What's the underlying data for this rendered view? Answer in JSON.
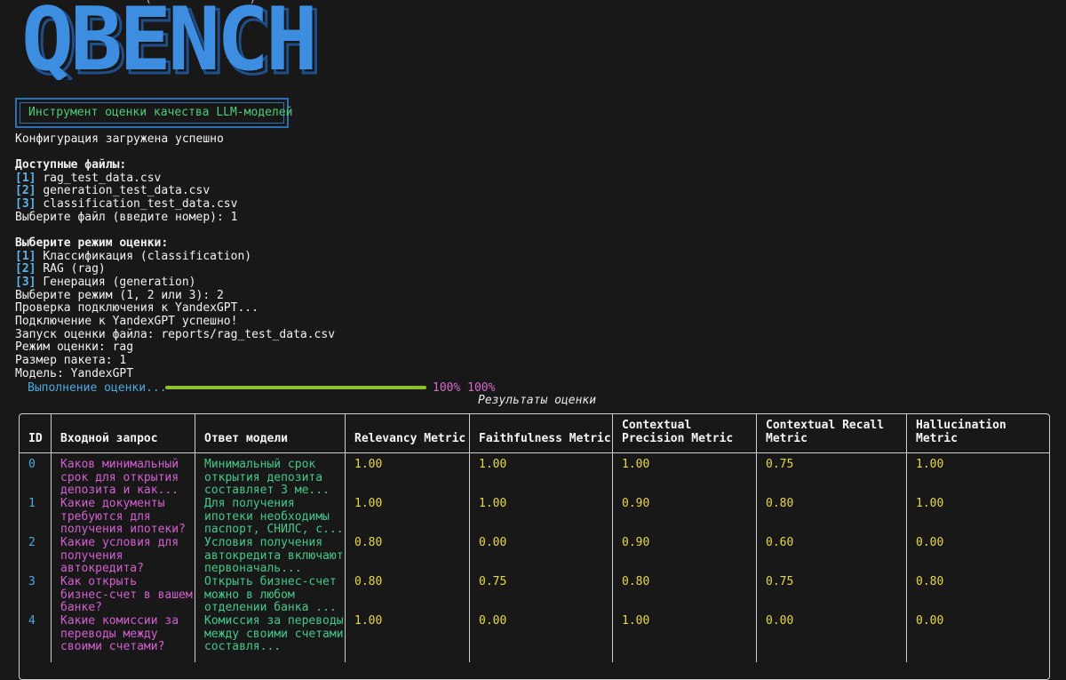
{
  "header_line": "                 (              )                        ",
  "logo_text": "QBENCH",
  "banner": "Инструмент оценки качества LLM-моделей",
  "config_loaded": "Конфигурация загружена успешно",
  "files_heading": "Доступные файлы:",
  "files": [
    {
      "num": "1",
      "name": "rag_test_data.csv"
    },
    {
      "num": "2",
      "name": "generation_test_data.csv"
    },
    {
      "num": "3",
      "name": "classification_test_data.csv"
    }
  ],
  "file_prompt": "Выберите файл (введите номер): 1",
  "mode_heading": "Выберите режим оценки:",
  "modes": [
    {
      "num": "1",
      "name": "Классификация (classification)"
    },
    {
      "num": "2",
      "name": "RAG (rag)"
    },
    {
      "num": "3",
      "name": "Генерация (generation)"
    }
  ],
  "log": [
    "Выберите режим (1, 2 или 3): 2",
    "Проверка подключения к YandexGPT...",
    "Подключение к YandexGPT успешно!",
    "Запуск оценки файла: reports/rag_test_data.csv",
    "Режим оценки: rag",
    "Размер пакета: 1",
    "Модель: YandexGPT"
  ],
  "progress": {
    "label": "Выполнение оценки...",
    "value": 1.0,
    "text": "100% 100%"
  },
  "results_caption": "Результаты оценки",
  "table": {
    "headers": [
      "ID",
      "Входной запрос",
      "Ответ модели",
      "Relevancy Metric",
      "Faithfulness Metric",
      "Contextual\nPrecision Metric",
      "Contextual Recall\nMetric",
      "Hallucination\nMetric"
    ],
    "rows": [
      {
        "id": "0",
        "q": "Каков минимальный\nсрок для открытия\nдепозита и как...",
        "a": "Минимальный срок\nоткрытия депозита\nсоставляет 3 ме...",
        "m": [
          "1.00",
          "1.00",
          "1.00",
          "0.75",
          "1.00"
        ]
      },
      {
        "id": "1",
        "q": "Какие документы\nтребуются для\nполучения ипотеки?",
        "a": "Для получения\nипотеки необходимы\nпаспорт, СНИЛС, с...",
        "m": [
          "1.00",
          "1.00",
          "0.90",
          "0.80",
          "1.00"
        ]
      },
      {
        "id": "2",
        "q": "Какие условия для\nполучения\nавтокредита?",
        "a": "Условия получения\nавтокредита включают\nпервоначаль...",
        "m": [
          "0.80",
          "0.00",
          "0.90",
          "0.60",
          "0.00"
        ]
      },
      {
        "id": "3",
        "q": "Как открыть\nбизнес-счет в вашем\nбанке?",
        "a": "Открыть бизнес-счет\nможно в любом\nотделении банка ...",
        "m": [
          "0.80",
          "0.75",
          "0.80",
          "0.75",
          "0.80"
        ]
      },
      {
        "id": "4",
        "q": "Какие комиссии за\nпереводы между\nсвоими счетами?",
        "a": "Комиссия за переводы\nмежду своими счетами\nсоставля...",
        "m": [
          "1.00",
          "0.00",
          "1.00",
          "0.00",
          "0.00"
        ]
      }
    ]
  }
}
